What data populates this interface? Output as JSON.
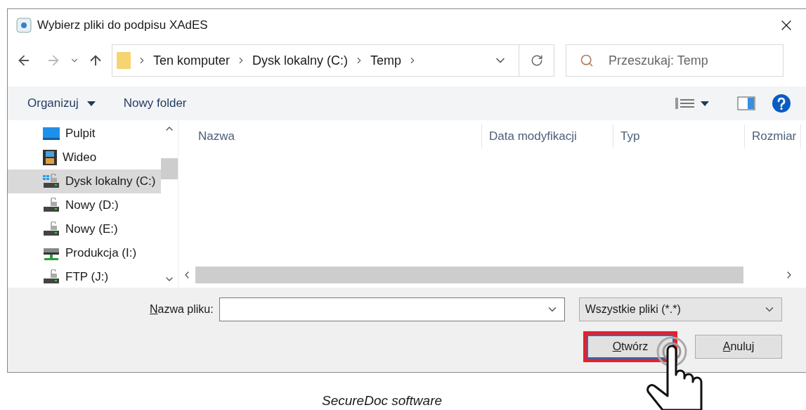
{
  "window": {
    "title": "Wybierz pliki do podpisu XAdES"
  },
  "address_bar": {
    "crumbs": [
      "Ten komputer",
      "Dysk lokalny (C:)",
      "Temp"
    ]
  },
  "search": {
    "placeholder": "Przeszukaj: Temp"
  },
  "toolbar": {
    "organize": "Organizuj",
    "new_folder": "Nowy folder"
  },
  "sidebar": {
    "items": [
      {
        "label": "Pulpit",
        "kind": "desktop",
        "selected": false
      },
      {
        "label": "Wideo",
        "kind": "video",
        "selected": false
      },
      {
        "label": "Dysk lokalny (C:)",
        "kind": "system-drive",
        "selected": true
      },
      {
        "label": "Nowy (D:)",
        "kind": "drive",
        "selected": false
      },
      {
        "label": "Nowy (E:)",
        "kind": "drive",
        "selected": false
      },
      {
        "label": "Produkcja (I:)",
        "kind": "network-drive",
        "selected": false
      },
      {
        "label": "FTP (J:)",
        "kind": "drive",
        "selected": false
      }
    ]
  },
  "table": {
    "columns": [
      "Nazwa",
      "Data modyfikacji",
      "Typ",
      "Rozmiar"
    ]
  },
  "file_name": {
    "label": "Nazwa pliku:"
  },
  "file_type": {
    "value": "Wszystkie pliki (*.*)"
  },
  "buttons": [
    {
      "label": "Otwórz",
      "highlighted": true
    },
    {
      "label": "Anuluj",
      "highlighted": false
    }
  ],
  "caption": "SecureDoc software"
}
